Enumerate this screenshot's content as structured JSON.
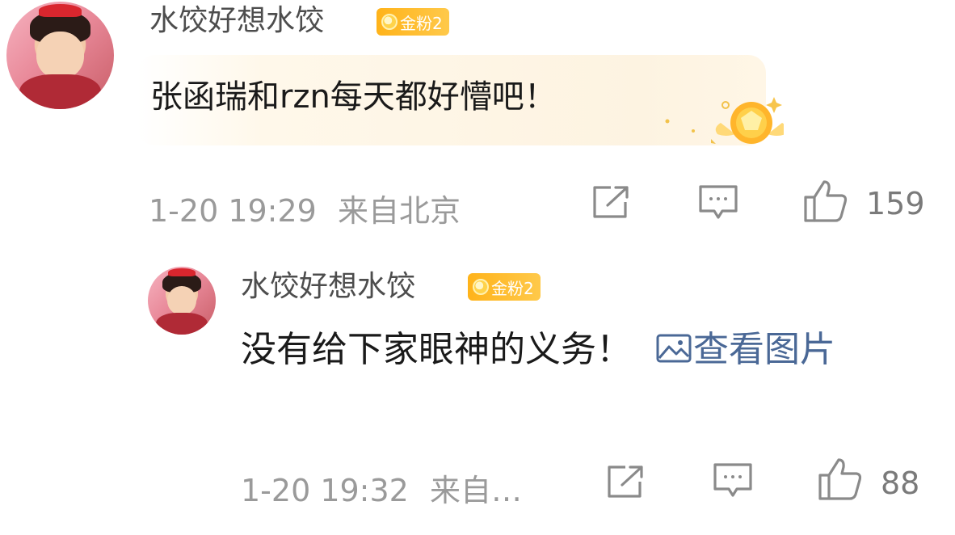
{
  "comment": {
    "username": "水饺好想水饺",
    "badge": "金粉2",
    "text": "张函瑞和rzn每天都好懵吧！",
    "time": "1-20 19:29",
    "location": "来自北京",
    "likes": "159"
  },
  "reply": {
    "username": "水饺好想水饺",
    "badge": "金粉2",
    "text": "没有给下家眼神的义务！",
    "view_image": "查看图片",
    "time": "1-20 19:32",
    "location": "来自…",
    "likes": "88"
  },
  "icons": {
    "forward": "share-square-icon",
    "comment": "comment-bubble-icon",
    "like": "thumbs-up-icon",
    "image": "image-icon",
    "decoration": "gold-badge-icon"
  },
  "colors": {
    "badge": "#ffb31a",
    "link": "#4a6896",
    "meta": "#9a9a9a"
  }
}
